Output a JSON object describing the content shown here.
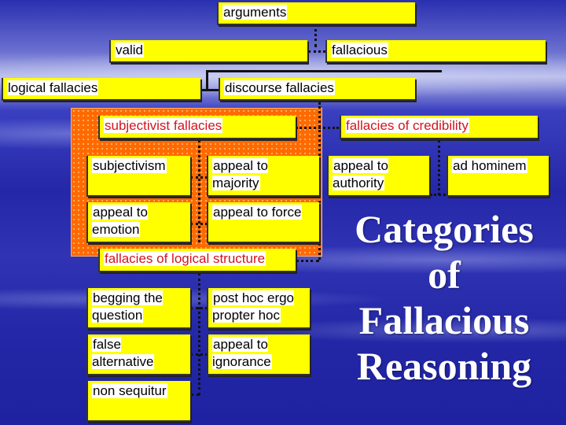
{
  "diagram": {
    "root": "arguments",
    "level1": {
      "valid": "valid",
      "fallacious": "fallacious"
    },
    "level2": {
      "logical": "logical fallacies",
      "discourse": "discourse fallacies"
    },
    "groups": {
      "subjectivist": {
        "label": "subjectivist fallacies",
        "items": [
          "subjectivism",
          "appeal to majority",
          "appeal to emotion",
          "appeal to force"
        ]
      },
      "credibility": {
        "label": "fallacies of credibility",
        "items": [
          "appeal to authority",
          "ad hominem"
        ]
      },
      "logical_structure": {
        "label": "fallacies of logical structure",
        "items": [
          "begging the question",
          "post hoc ergo propter hoc",
          "false alternative",
          "appeal to ignorance",
          "non sequitur"
        ]
      }
    }
  },
  "title": {
    "line1": "Categories",
    "line2": "of",
    "line3": "Fallacious",
    "line4": "Reasoning"
  },
  "colors": {
    "box": "#ffff00",
    "highlight": "#ff6a00",
    "group_text": "#d4141c",
    "background": "#2428a8"
  }
}
